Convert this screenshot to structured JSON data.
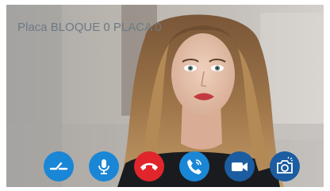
{
  "panel": {
    "title": "Placa BLOQUE 0 PLACA 0"
  },
  "controls": [
    {
      "name": "open-door",
      "icon": "door-unlock-icon",
      "color": "#1a86d6"
    },
    {
      "name": "microphone",
      "icon": "microphone-icon",
      "color": "#1a86d6"
    },
    {
      "name": "hang-up",
      "icon": "hang-up-phone-icon",
      "color": "#e0262c"
    },
    {
      "name": "answer-call",
      "icon": "phone-call-icon",
      "color": "#1a86d6"
    },
    {
      "name": "video",
      "icon": "video-camera-icon",
      "color": "#1b5da0"
    },
    {
      "name": "snapshot",
      "icon": "photo-camera-icon",
      "color": "#1b5da0"
    }
  ]
}
